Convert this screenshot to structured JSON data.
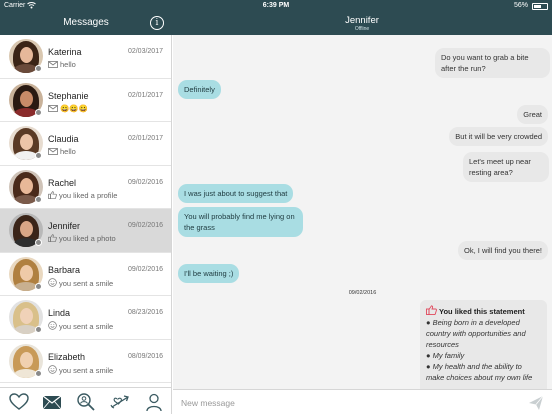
{
  "status_bar": {
    "carrier": "Carrier",
    "time": "6:39 PM",
    "battery": "56%",
    "battery_level": 0.56
  },
  "sidebar": {
    "title": "Messages"
  },
  "chat_header": {
    "name": "Jennifer",
    "status": "Offline"
  },
  "contacts": [
    {
      "name": "Katerina",
      "date": "02/03/2017",
      "preview": "hello",
      "icon": "envelope-icon"
    },
    {
      "name": "Stephanie",
      "date": "02/01/2017",
      "preview": "😀😀😀",
      "icon": "envelope-icon"
    },
    {
      "name": "Claudia",
      "date": "02/01/2017",
      "preview": "hello",
      "icon": "envelope-icon"
    },
    {
      "name": "Rachel",
      "date": "09/02/2016",
      "preview": "you liked a profile",
      "icon": "thumbs-up-icon"
    },
    {
      "name": "Jennifer",
      "date": "09/02/2016",
      "preview": "you liked a photo",
      "icon": "thumbs-up-icon",
      "active": true
    },
    {
      "name": "Barbara",
      "date": "09/02/2016",
      "preview": "you sent a smile",
      "icon": "smile-icon"
    },
    {
      "name": "Linda",
      "date": "08/23/2016",
      "preview": "you sent a smile",
      "icon": "smile-icon"
    },
    {
      "name": "Elizabeth",
      "date": "08/09/2016",
      "preview": "you sent a smile",
      "icon": "smile-icon"
    }
  ],
  "messages": [
    {
      "dir": "out",
      "text": "Do you want to grab a bite after the run?"
    },
    {
      "dir": "in",
      "text": "Definitely"
    },
    {
      "dir": "out",
      "text": "Great"
    },
    {
      "dir": "out",
      "text": "But it will be very crowded"
    },
    {
      "dir": "out",
      "text": "Let's meet up near resting area?"
    },
    {
      "dir": "in",
      "text": "I was just about to suggest that"
    },
    {
      "dir": "in",
      "text": "You will probably find me lying on the grass"
    },
    {
      "dir": "out",
      "text": "Ok, I will find you there!"
    },
    {
      "dir": "in",
      "text": "I'll be waiting ;)"
    }
  ],
  "date_separator": "09/02/2016",
  "like_card": {
    "title": "You liked this statement",
    "items": [
      "Being born in a developed country with opportunities and resources",
      "My family",
      "My health and the ability to make choices about my own life"
    ]
  },
  "input": {
    "placeholder": "New message",
    "value": ""
  },
  "colors": {
    "header": "#2d4b52",
    "incoming_bubble": "#a9dde3",
    "outgoing_bubble": "#e8e8e8",
    "chat_bg": "#f3f3f3",
    "like_icon": "#e0475b"
  }
}
